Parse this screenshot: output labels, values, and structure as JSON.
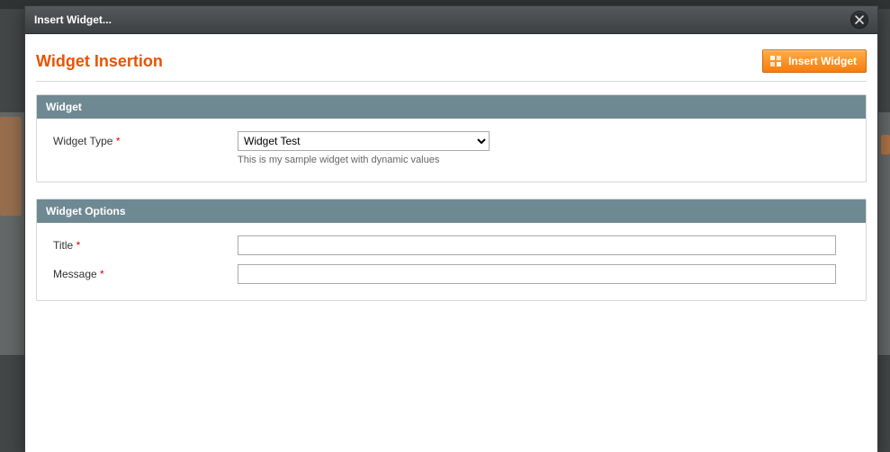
{
  "modal": {
    "title": "Insert Widget..."
  },
  "header": {
    "page_title": "Widget Insertion",
    "insert_button": "Insert Widget"
  },
  "widget": {
    "section_title": "Widget",
    "type_label": "Widget Type",
    "type_selected": "Widget Test",
    "type_hint": "This is my sample widget with dynamic values"
  },
  "options": {
    "section_title": "Widget Options",
    "title_label": "Title",
    "title_value": "",
    "message_label": "Message",
    "message_value": ""
  }
}
